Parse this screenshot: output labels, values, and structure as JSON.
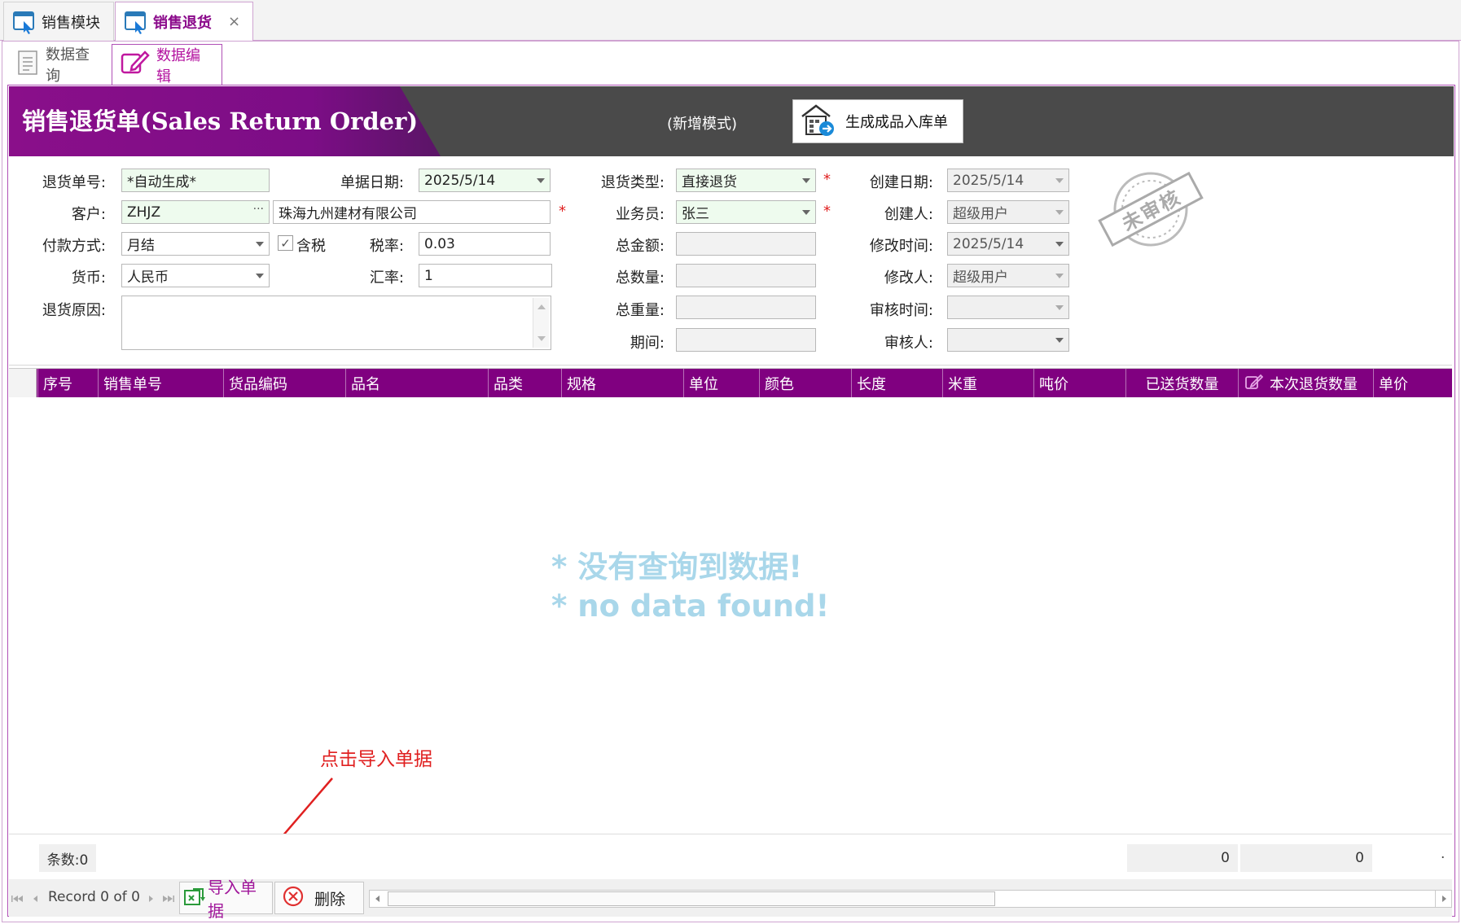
{
  "tabs": [
    {
      "label": "销售模块"
    },
    {
      "label": "销售退货"
    }
  ],
  "close_glyph": "×",
  "subtabs": [
    {
      "label": "数据查询"
    },
    {
      "label": "数据编辑"
    }
  ],
  "header": {
    "title": "销售退货单(Sales Return Order)",
    "mode": "(新增模式)",
    "action_button": "生成成品入库单"
  },
  "form": {
    "return_no": {
      "label": "退货单号:",
      "value": "*自动生成*"
    },
    "doc_date": {
      "label": "单据日期:",
      "value": "2025/5/14"
    },
    "return_type": {
      "label": "退货类型:",
      "value": "直接退货"
    },
    "create_date": {
      "label": "创建日期:",
      "value": "2025/5/14"
    },
    "customer": {
      "label": "客户:",
      "code": "ZHJZ",
      "name": "珠海九州建材有限公司",
      "ellipsis": "···"
    },
    "salesperson": {
      "label": "业务员:",
      "value": "张三"
    },
    "creator": {
      "label": "创建人:",
      "value": "超级用户"
    },
    "payment": {
      "label": "付款方式:",
      "value": "月结"
    },
    "tax_included": {
      "label": "含税",
      "checked": true,
      "check_glyph": "✓"
    },
    "tax_rate": {
      "label": "税率:",
      "value": "0.03"
    },
    "total_amount": {
      "label": "总金额:",
      "value": ""
    },
    "modify_time": {
      "label": "修改时间:",
      "value": "2025/5/14"
    },
    "currency": {
      "label": "货币:",
      "value": "人民币"
    },
    "exchange_rate": {
      "label": "汇率:",
      "value": "1"
    },
    "total_qty": {
      "label": "总数量:",
      "value": ""
    },
    "modifier": {
      "label": "修改人:",
      "value": "超级用户"
    },
    "reason": {
      "label": "退货原因:",
      "value": ""
    },
    "total_weight": {
      "label": "总重量:",
      "value": ""
    },
    "audit_time": {
      "label": "审核时间:",
      "value": ""
    },
    "period": {
      "label": "期间:",
      "value": ""
    },
    "auditor": {
      "label": "审核人:",
      "value": ""
    },
    "required_mark": "*"
  },
  "stamp": {
    "text": "未审核"
  },
  "grid": {
    "columns": [
      "序号",
      "销售单号",
      "货品编码",
      "品名",
      "品类",
      "规格",
      "单位",
      "颜色",
      "长度",
      "米重",
      "吨价",
      "已送货数量",
      "本次退货数量",
      "单价"
    ],
    "empty_message": [
      "* 没有查询到数据!",
      "* no data found!"
    ]
  },
  "summary": {
    "count_label": "条数:0",
    "sum1": "0",
    "sum2": "0",
    "dot": "."
  },
  "navigator": {
    "record_text": "Record 0 of 0",
    "import_button": "导入单据",
    "delete_button": "删除"
  },
  "annotation": {
    "text": "点击导入单据",
    "color": "#e02020"
  },
  "colors": {
    "accent": "#800080",
    "banner_dark": "#4a4a4a",
    "required": "#e02020",
    "empty_text": "#a9d7ea"
  }
}
